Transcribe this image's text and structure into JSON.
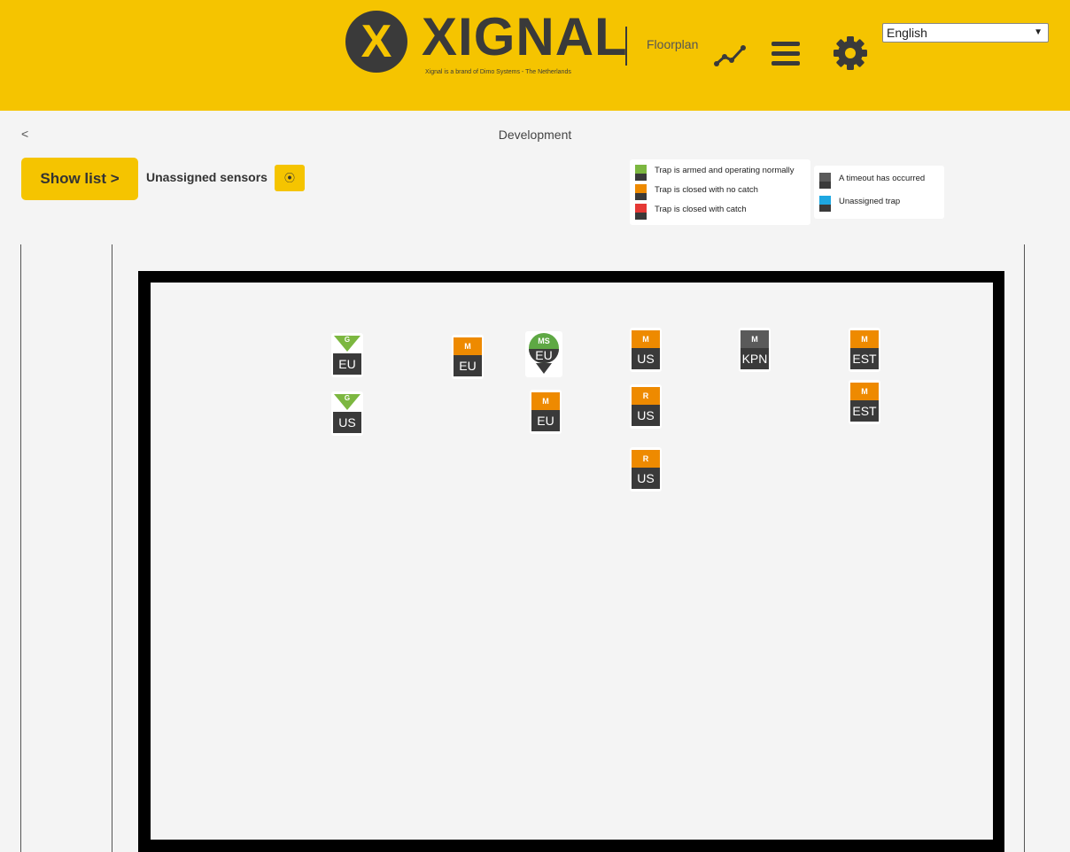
{
  "header": {
    "logo_letter": "X",
    "brand": "XIGNAL",
    "tagline": "Xignal is a brand of Dimo Systems - The Netherlands",
    "floorplan_link": "Floorplan",
    "language": "English",
    "accent_color": "#f5c400"
  },
  "nav": {
    "back": "<",
    "title": "Development"
  },
  "toolbar": {
    "show_list": "Show list >",
    "unassigned_label": "Unassigned sensors",
    "unassigned_icon": "⦿"
  },
  "legend": {
    "left": [
      {
        "color": "#7cb740",
        "text": "Trap is armed and operating normally"
      },
      {
        "color": "#ee8a00",
        "text": "Trap is closed with no catch"
      },
      {
        "color": "#e53935",
        "text": "Trap is closed with catch"
      }
    ],
    "right": [
      {
        "color": "#5a5a5a",
        "text": "A timeout has occurred"
      },
      {
        "color": "#1ea7e1",
        "text": "Unassigned trap"
      }
    ]
  },
  "markers": [
    {
      "flag": "G",
      "label": "EU",
      "style": "green-tri"
    },
    {
      "flag": "G",
      "label": "US",
      "style": "green-tri"
    },
    {
      "flag": "M",
      "label": "EU",
      "style": "orange"
    },
    {
      "flag": "MS",
      "label": "EU",
      "style": "pin"
    },
    {
      "flag": "M",
      "label": "EU",
      "style": "orange"
    },
    {
      "flag": "M",
      "label": "US",
      "style": "orange"
    },
    {
      "flag": "R",
      "label": "US",
      "style": "orange"
    },
    {
      "flag": "R",
      "label": "US",
      "style": "orange"
    },
    {
      "flag": "M",
      "label": "KPN",
      "style": "grey"
    },
    {
      "flag": "M",
      "label": "EST",
      "style": "orange"
    },
    {
      "flag": "M",
      "label": "EST",
      "style": "orange"
    }
  ]
}
